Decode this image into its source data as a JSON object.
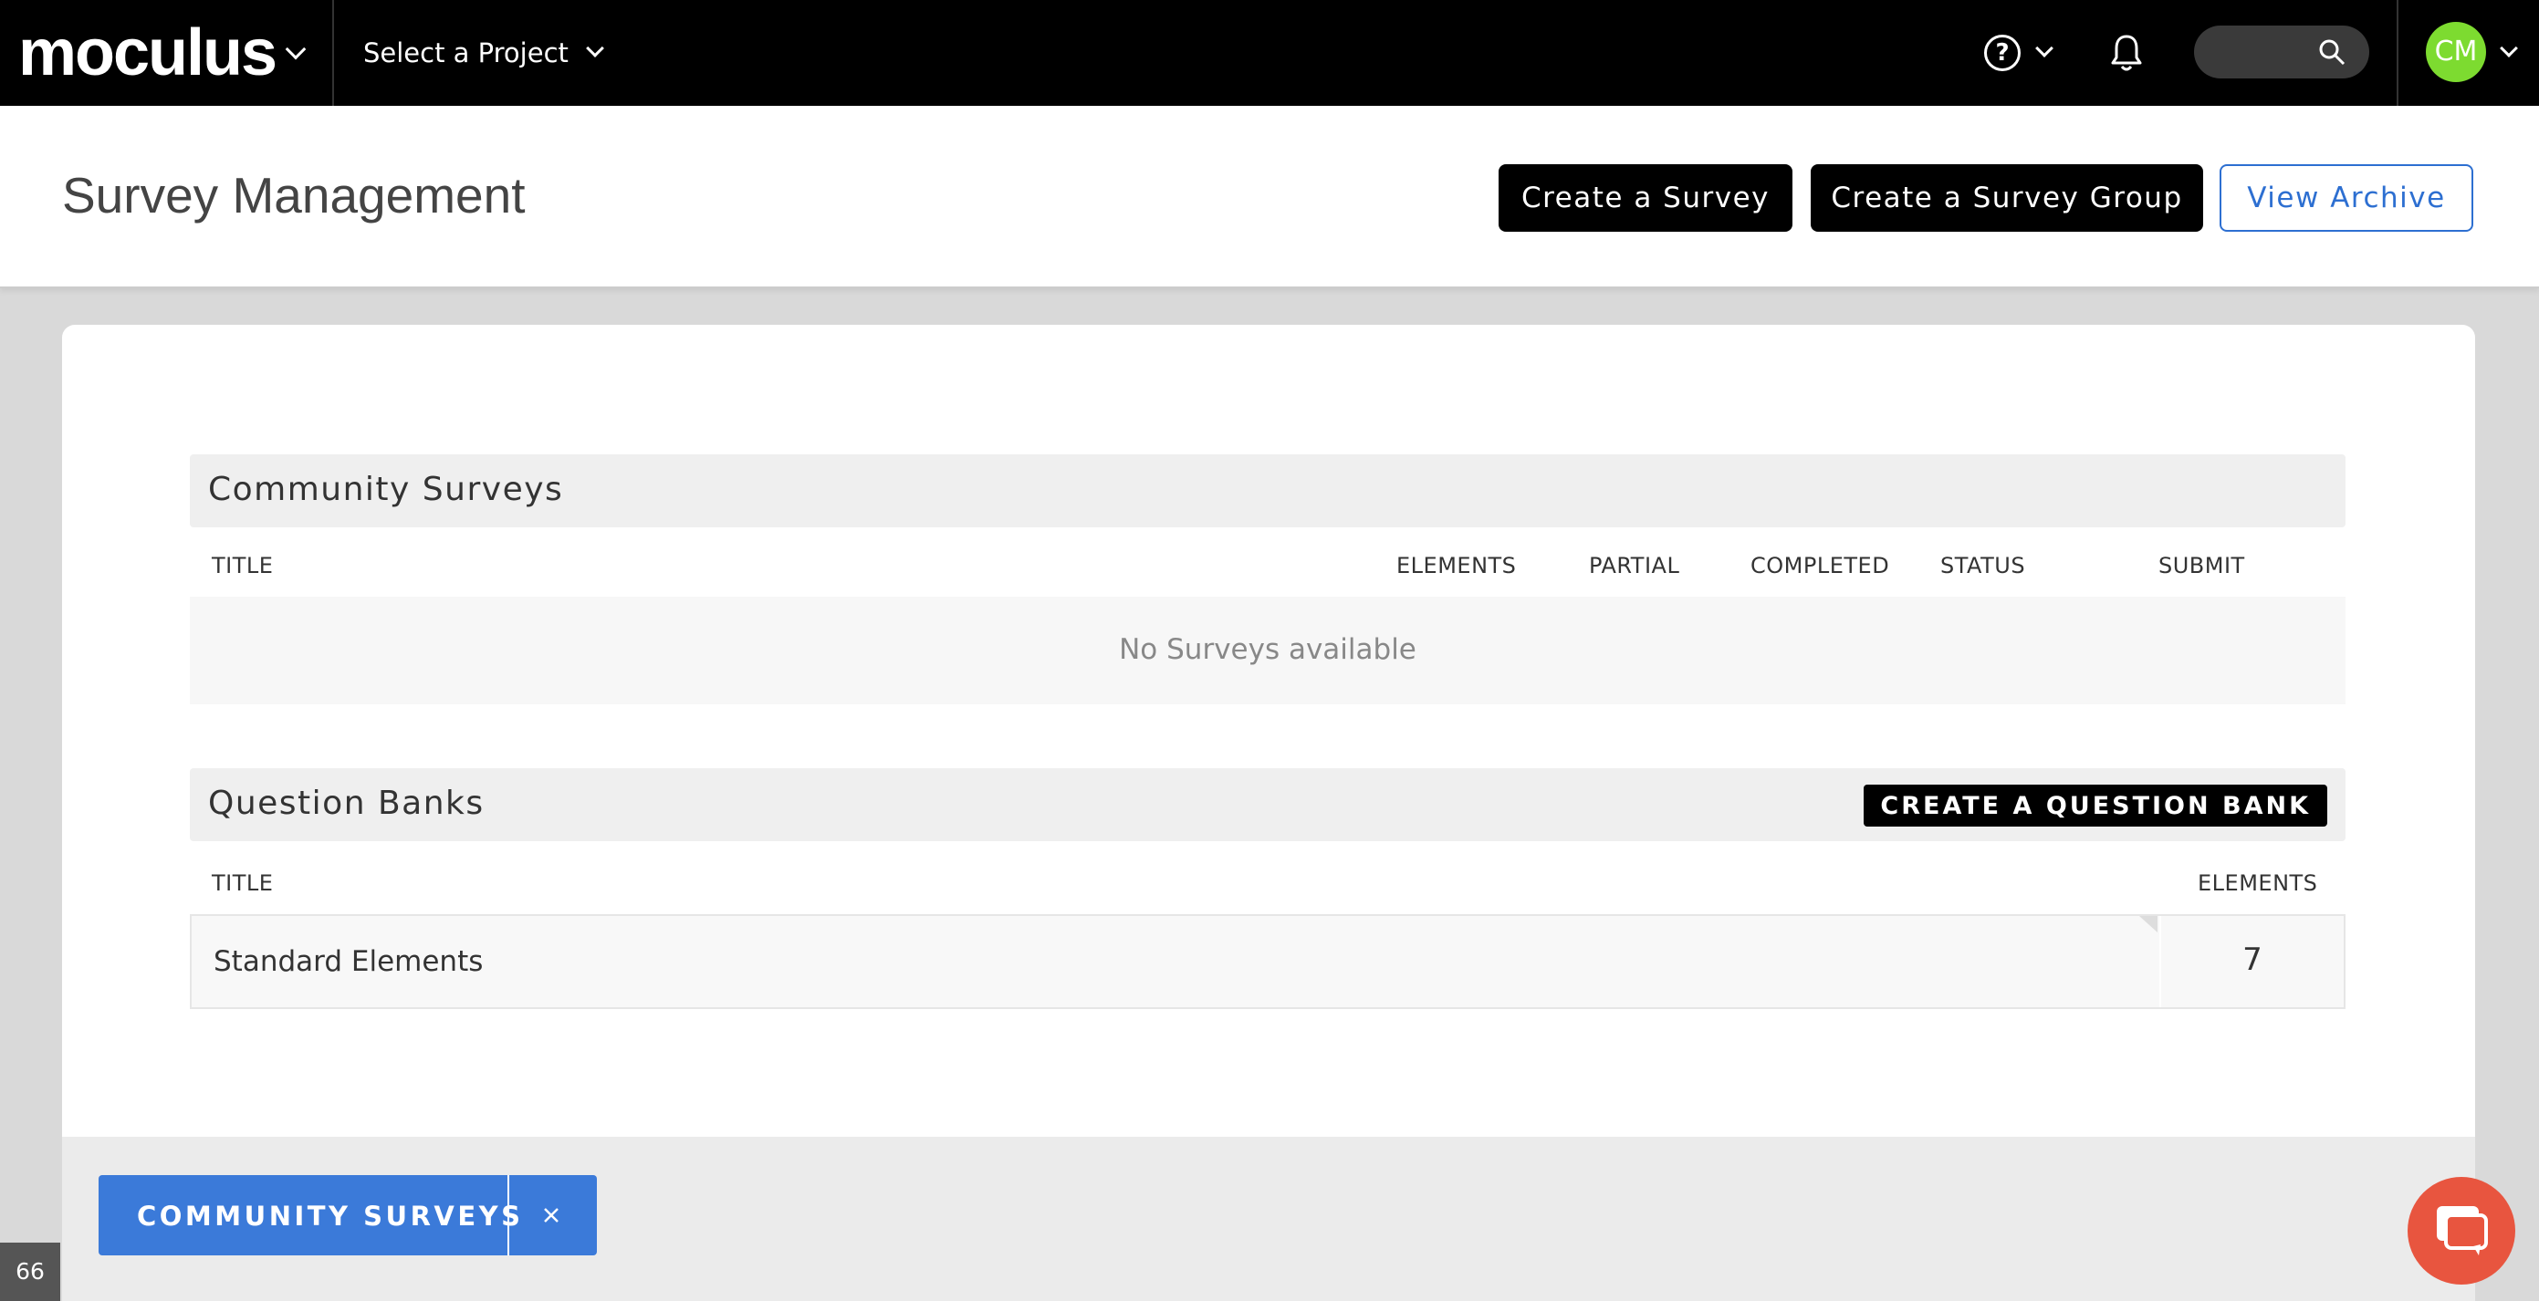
{
  "nav": {
    "logo": "moculus",
    "project_select": "Select a Project",
    "help_symbol": "?",
    "avatar_initials": "CM"
  },
  "header": {
    "title": "Survey Management",
    "create_survey": "Create a Survey",
    "create_survey_group": "Create a Survey Group",
    "view_archive": "View Archive"
  },
  "community_surveys": {
    "title": "Community Surveys",
    "columns": [
      "TITLE",
      "ELEMENTS",
      "PARTIAL",
      "COMPLETED",
      "STATUS",
      "SUBMIT"
    ],
    "empty_text": "No Surveys available"
  },
  "question_banks": {
    "title": "Question Banks",
    "create_button": "CREATE A QUESTION BANK",
    "columns": [
      "TITLE",
      "ELEMENTS"
    ],
    "rows": [
      {
        "title": "Standard Elements",
        "elements": "7"
      }
    ]
  },
  "bottom": {
    "tab_label": "COMMUNITY SURVEYS",
    "page_number": "66"
  },
  "colors": {
    "accent": "#3b7ad9",
    "avatar": "#7ddb30",
    "chat": "#e8553f"
  }
}
